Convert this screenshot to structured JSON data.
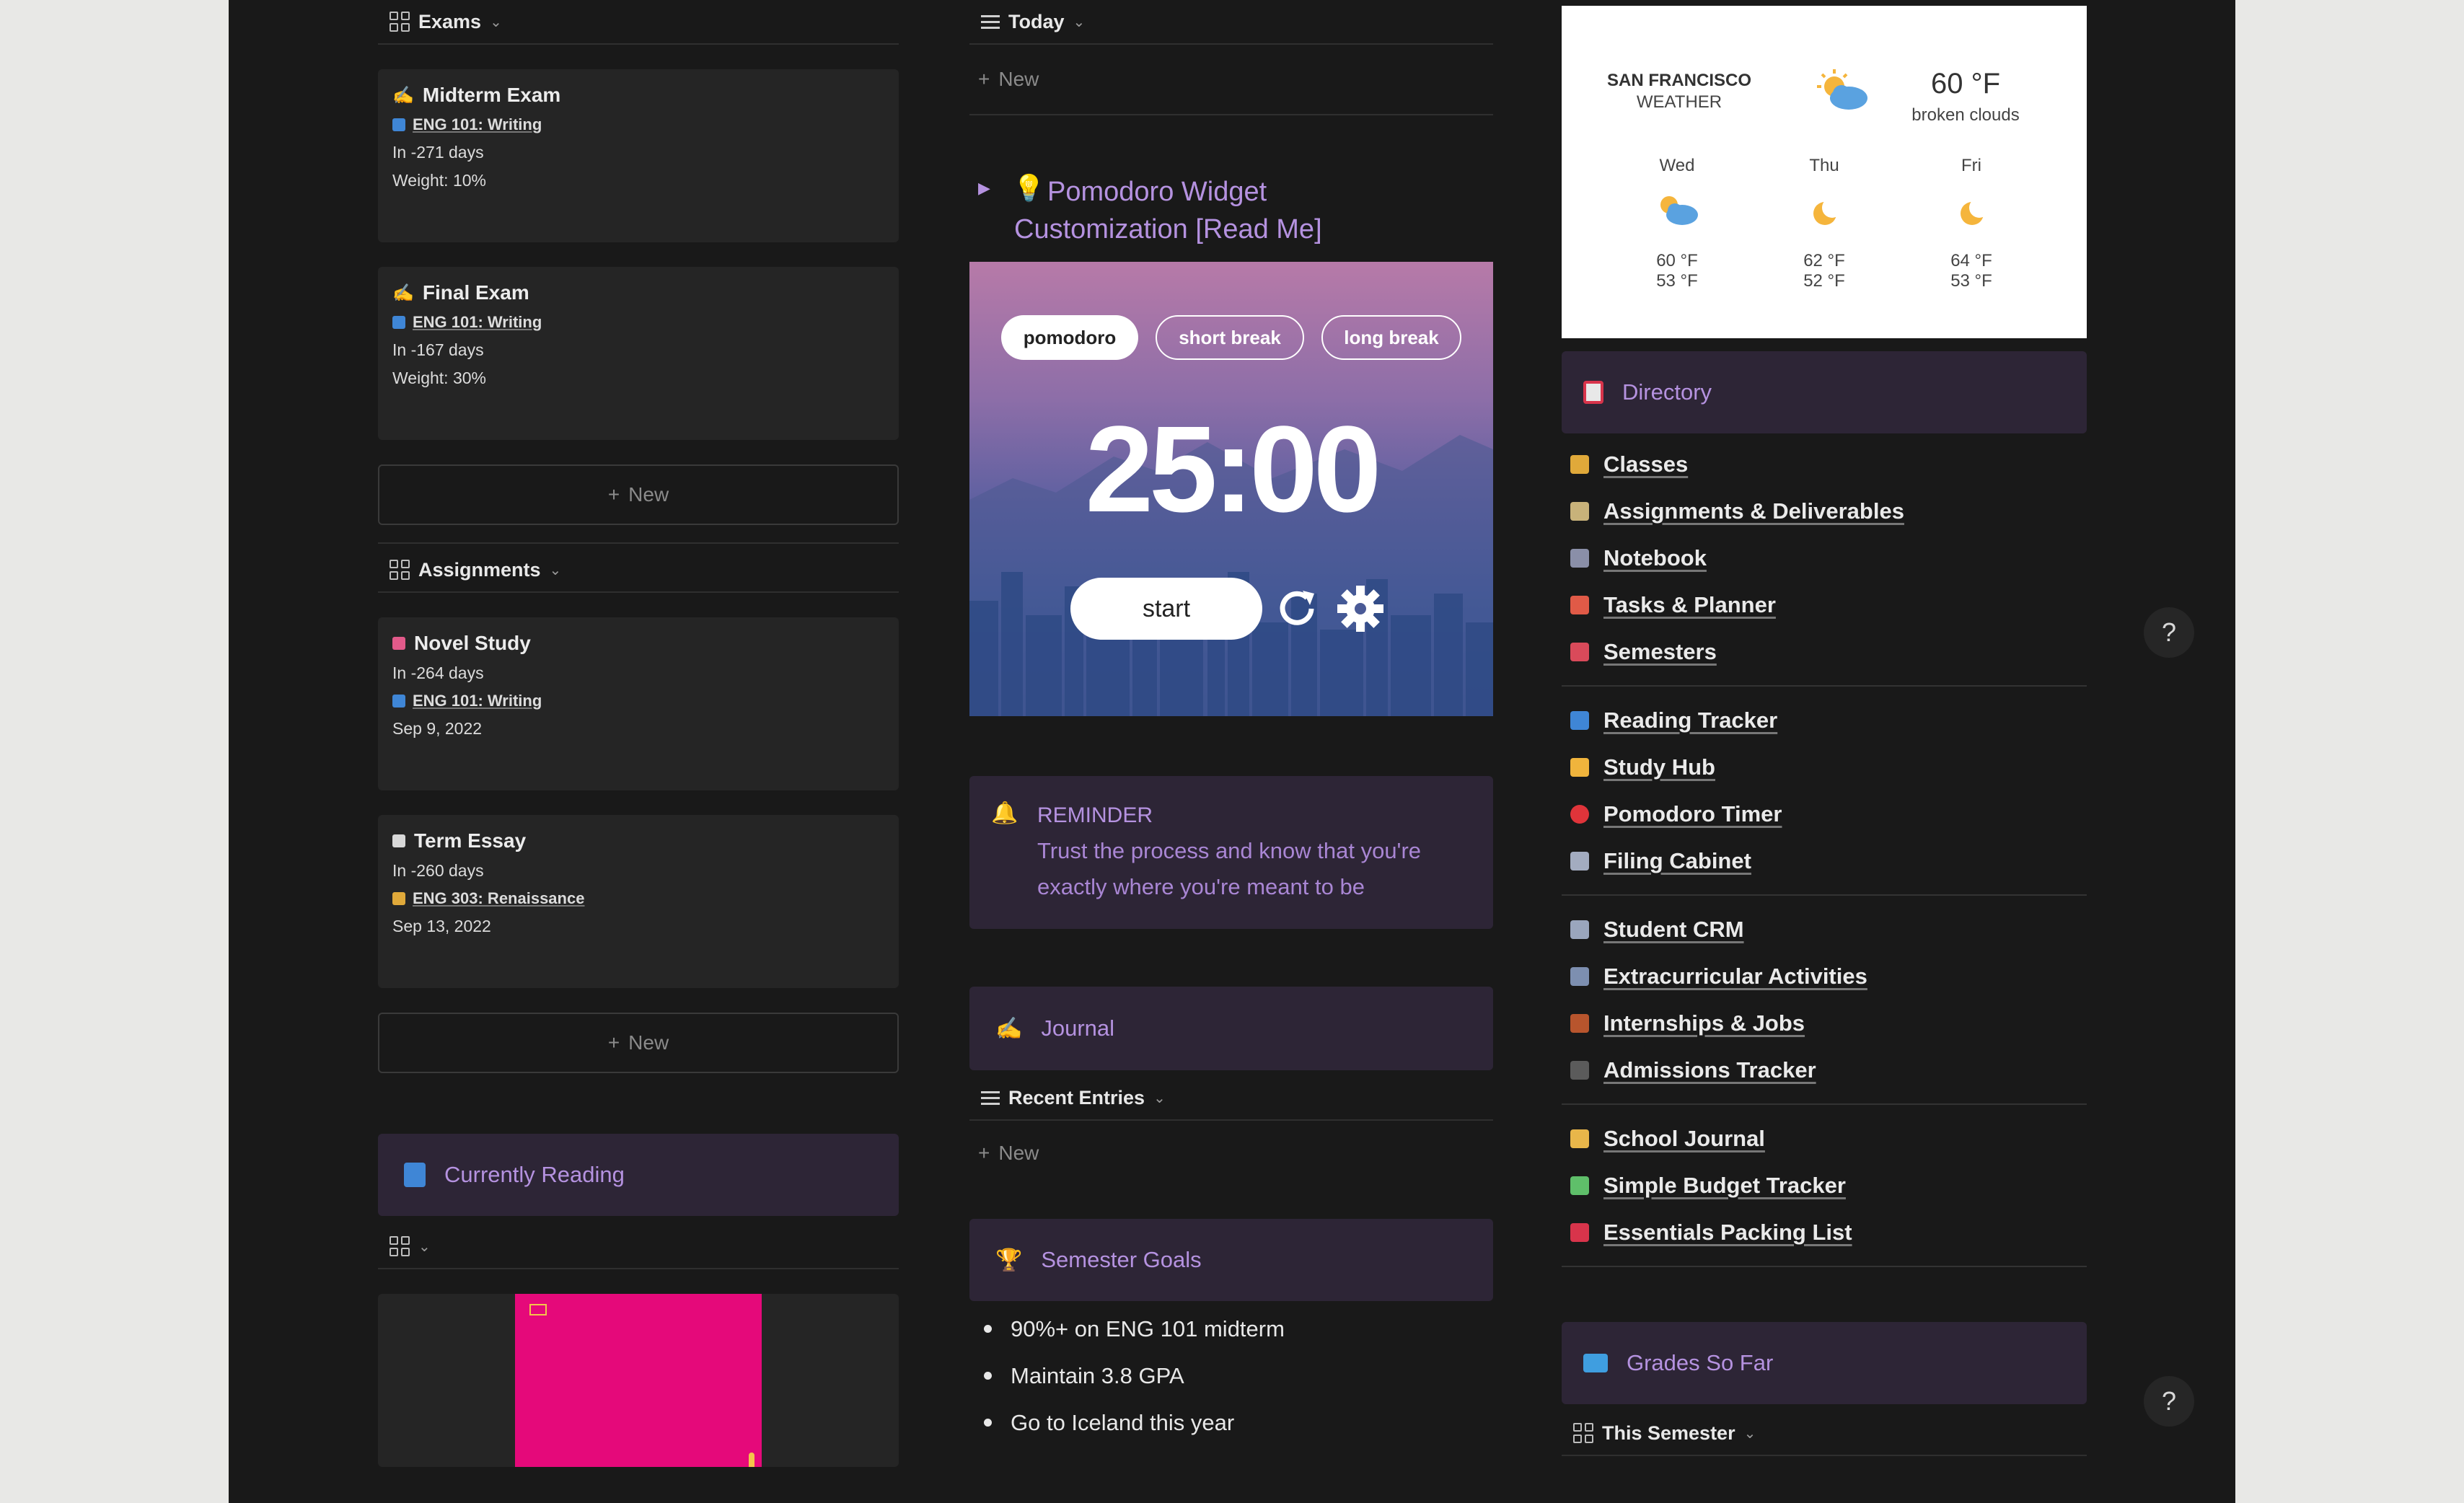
{
  "exams": {
    "view_label": "Exams",
    "cards": [
      {
        "title": "Midterm Exam",
        "course": "ENG 101: Writing",
        "due": "In -271 days",
        "weight": "Weight: 10%"
      },
      {
        "title": "Final Exam",
        "course": "ENG 101: Writing",
        "due": "In -167 days",
        "weight": "Weight: 30%"
      }
    ],
    "new_label": "New"
  },
  "assignments": {
    "view_label": "Assignments",
    "cards": [
      {
        "title": "Novel Study",
        "due": "In -264 days",
        "course": "ENG 101: Writing",
        "date": "Sep 9, 2022"
      },
      {
        "title": "Term Essay",
        "due": "In -260 days",
        "course": "ENG 303: Renaissance",
        "date": "Sep 13, 2022"
      }
    ],
    "new_label": "New"
  },
  "currently_reading": {
    "title": "Currently Reading",
    "book_cover_color": "#e5097a"
  },
  "today": {
    "view_label": "Today",
    "new_label": "New"
  },
  "pomodoro": {
    "toggle_title_line1": "Pomodoro Widget",
    "toggle_title_line2": "Customization [Read Me]",
    "modes": [
      "pomodoro",
      "short break",
      "long break"
    ],
    "time": "25:00",
    "start_label": "start"
  },
  "reminder": {
    "label": "REMINDER",
    "line1": "Trust the process and know that you're",
    "line2": "exactly where you're meant to be"
  },
  "journal": {
    "title": "Journal",
    "view_label": "Recent Entries",
    "new_label": "New"
  },
  "semester_goals": {
    "title": "Semester Goals",
    "items": [
      "90%+ on ENG 101 midterm",
      "Maintain 3.8 GPA",
      "Go to Iceland this year"
    ]
  },
  "weather": {
    "city": "SAN FRANCISCO",
    "label": "WEATHER",
    "current_temp": "60 °F",
    "condition": "broken clouds",
    "days": [
      {
        "day": "Wed",
        "high": "60 °F",
        "low": "53 °F",
        "icon": "partly-cloudy-sun-icon"
      },
      {
        "day": "Thu",
        "high": "62 °F",
        "low": "52 °F",
        "icon": "moon-icon"
      },
      {
        "day": "Fri",
        "high": "64 °F",
        "low": "53 °F",
        "icon": "moon-icon"
      }
    ]
  },
  "directory": {
    "title": "Directory",
    "groups": [
      [
        {
          "label": "Classes",
          "color": "#e0a93a"
        },
        {
          "label": "Assignments & Deliverables",
          "color": "#c8b27a"
        },
        {
          "label": "Notebook",
          "color": "#8a8fa8"
        },
        {
          "label": "Tasks & Planner",
          "color": "#e05a47"
        },
        {
          "label": "Semesters",
          "color": "#d94a5a"
        }
      ],
      [
        {
          "label": "Reading Tracker",
          "color": "#3f86d6"
        },
        {
          "label": "Study Hub",
          "color": "#f0b43c"
        },
        {
          "label": "Pomodoro Timer",
          "color": "#e0343a"
        },
        {
          "label": "Filing Cabinet",
          "color": "#a3acc0"
        }
      ],
      [
        {
          "label": "Student CRM",
          "color": "#9aa6bd"
        },
        {
          "label": "Extracurricular Activities",
          "color": "#7d8fb0"
        },
        {
          "label": "Internships & Jobs",
          "color": "#b8552d"
        },
        {
          "label": "Admissions Tracker",
          "color": "#5b5b5b"
        }
      ],
      [
        {
          "label": "School Journal",
          "color": "#e8b64a"
        },
        {
          "label": "Simple Budget Tracker",
          "color": "#5fbf6a"
        },
        {
          "label": "Essentials Packing List",
          "color": "#d8344b"
        }
      ]
    ]
  },
  "grades": {
    "title": "Grades So Far",
    "view_label": "This Semester"
  },
  "help_label": "?"
}
